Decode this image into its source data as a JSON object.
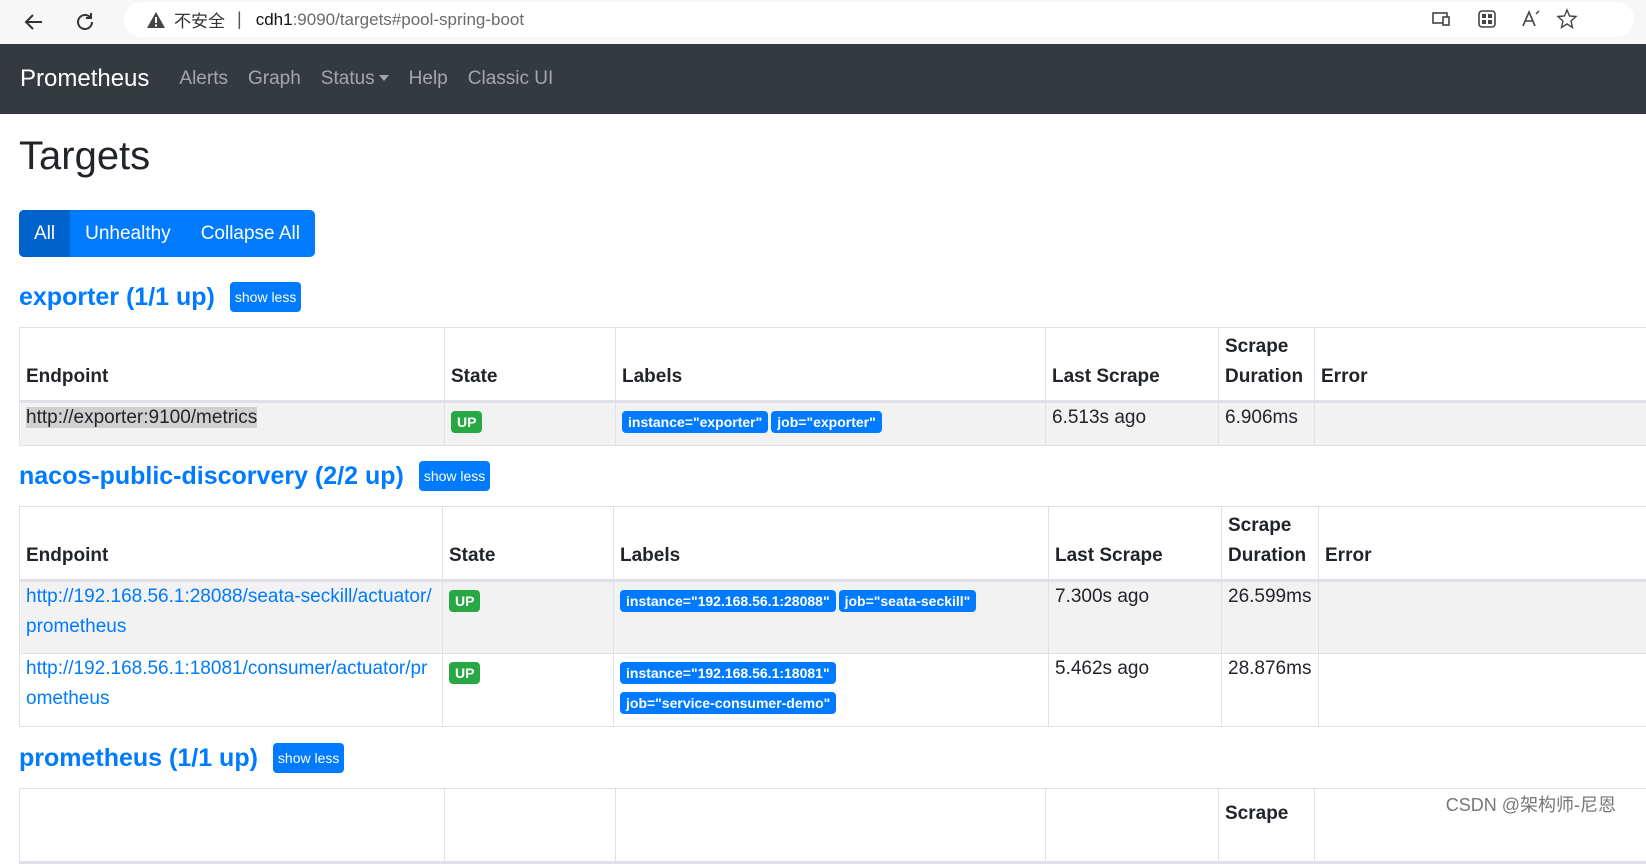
{
  "browser": {
    "insecure_label": "不安全",
    "separator": "|",
    "url_host": "cdh1",
    "url_rest": ":9090/targets#pool-spring-boot"
  },
  "navbar": {
    "brand": "Prometheus",
    "links": [
      "Alerts",
      "Graph",
      "Status",
      "Help",
      "Classic UI"
    ]
  },
  "page": {
    "title": "Targets",
    "filters": [
      "All",
      "Unhealthy",
      "Collapse All"
    ]
  },
  "columns": {
    "endpoint": "Endpoint",
    "state": "State",
    "labels": "Labels",
    "last_scrape": "Last Scrape",
    "scrape_duration_1": "Scrape",
    "scrape_duration_2": "Duration",
    "error": "Error"
  },
  "show_less_label": "show less",
  "pools": [
    {
      "title": "exporter (1/1 up)",
      "targets": [
        {
          "endpoint": "http://exporter:9100/metrics",
          "state": "UP",
          "labels": [
            "instance=\"exporter\"",
            "job=\"exporter\""
          ],
          "last_scrape": "6.513s ago",
          "scrape_duration": "6.906ms",
          "error": ""
        }
      ]
    },
    {
      "title": "nacos-public-discorvery (2/2 up)",
      "targets": [
        {
          "endpoint": "http://192.168.56.1:28088/seata-seckill/actuator/prometheus",
          "state": "UP",
          "labels": [
            "instance=\"192.168.56.1:28088\"",
            "job=\"seata-seckill\""
          ],
          "last_scrape": "7.300s ago",
          "scrape_duration": "26.599ms",
          "error": ""
        },
        {
          "endpoint": "http://192.168.56.1:18081/consumer/actuator/prometheus",
          "state": "UP",
          "labels": [
            "instance=\"192.168.56.1:18081\"",
            "job=\"service-consumer-demo\""
          ],
          "last_scrape": "5.462s ago",
          "scrape_duration": "28.876ms",
          "error": ""
        }
      ]
    },
    {
      "title": "prometheus (1/1 up)",
      "targets": []
    }
  ],
  "watermark": "CSDN @架构师-尼恩",
  "colors": {
    "primary": "#007bff",
    "success": "#28a745",
    "navbar": "#343a40"
  }
}
